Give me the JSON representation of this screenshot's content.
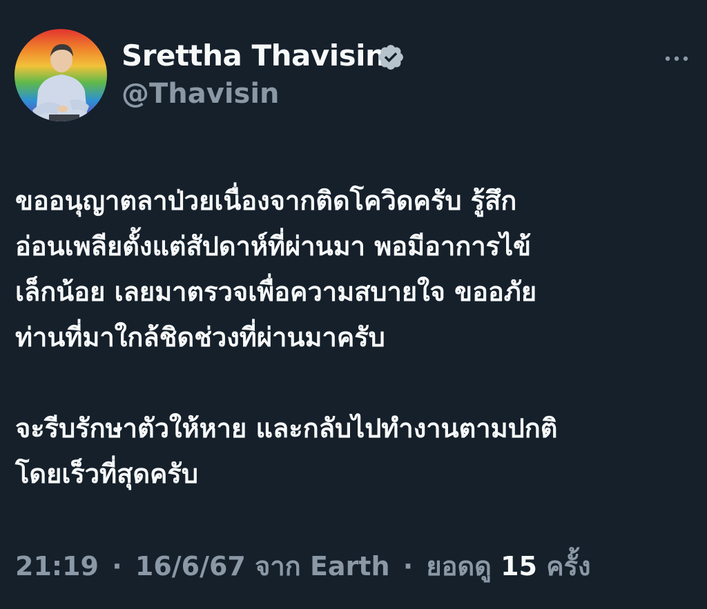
{
  "author": {
    "name": "Srettha Thavisin",
    "handle": "@Thavisin",
    "verified_icon": "verified-badge-icon"
  },
  "more_icon": "more-horizontal-icon",
  "body": {
    "paragraph1": [
      "ขออนุญาตลาป่วยเนื่องจากติดโควิดครับ รู้สึก",
      "อ่อนเพลียตั้งแต่สัปดาห์ที่ผ่านมา พอมีอาการไข้",
      "เล็กน้อย เลยมาตรวจเพื่อความสบายใจ ขออภัย",
      "ท่านที่มาใกล้ชิดช่วงที่ผ่านมาครับ"
    ],
    "paragraph2": [
      "จะรีบรักษาตัวให้หาย และกลับไปทำงานตามปกติ",
      "โดยเร็วที่สุดครับ"
    ]
  },
  "meta": {
    "time": "21:19",
    "separator": "·",
    "date": "16/6/67",
    "source_prefix": "จาก",
    "source": "Earth",
    "views_prefix": "ยอดดู",
    "views_count": "15",
    "views_suffix": "ครั้ง"
  },
  "colors": {
    "background": "#15202b",
    "text_primary": "#f7f9f9",
    "text_secondary": "#8b98a5",
    "verified_badge": "#b7c3cc"
  }
}
